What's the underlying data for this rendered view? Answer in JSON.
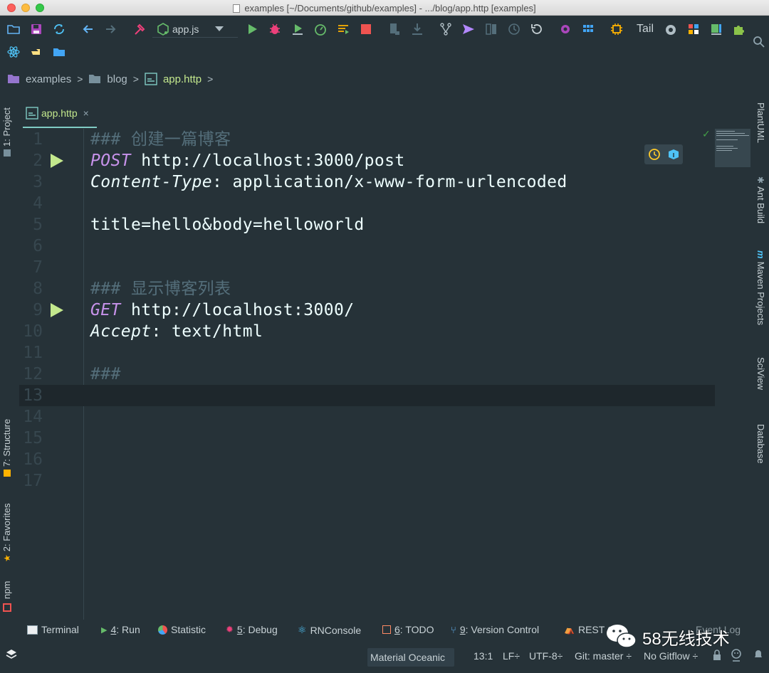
{
  "window": {
    "title": "examples [~/Documents/github/examples] - .../blog/app.http [examples]"
  },
  "toolbar": {
    "run_config": "app.js",
    "tail_label": "Tail"
  },
  "breadcrumb": {
    "items": [
      "examples",
      "blog",
      "app.http"
    ]
  },
  "left_tabs": {
    "project": "1: Project",
    "structure": "7: Structure",
    "favorites": "2: Favorites",
    "npm": "npm"
  },
  "right_tabs": {
    "plantuml": "PlantUML",
    "ant_build": "Ant Build",
    "maven": "Maven Projects",
    "sciview": "SciView",
    "database": "Database"
  },
  "editor": {
    "tab_label": "app.http",
    "current_line": 13,
    "lines": [
      {
        "n": "1",
        "segments": [
          {
            "t": "### 创建一篇博客",
            "c": "comment"
          }
        ]
      },
      {
        "n": "2",
        "run": true,
        "segments": [
          {
            "t": "POST",
            "c": "method"
          },
          {
            "t": " http://localhost:3000/post",
            "c": "plain"
          }
        ]
      },
      {
        "n": "3",
        "segments": [
          {
            "t": "Content-Type",
            "c": "header"
          },
          {
            "t": ": application/x-www-form-urlencoded",
            "c": "plain"
          }
        ]
      },
      {
        "n": "4",
        "segments": []
      },
      {
        "n": "5",
        "segments": [
          {
            "t": "title=hello&body=helloworld",
            "c": "plain"
          }
        ]
      },
      {
        "n": "6",
        "segments": []
      },
      {
        "n": "7",
        "segments": []
      },
      {
        "n": "8",
        "segments": [
          {
            "t": "### 显示博客列表",
            "c": "comment"
          }
        ]
      },
      {
        "n": "9",
        "run": true,
        "segments": [
          {
            "t": "GET",
            "c": "method"
          },
          {
            "t": " http://localhost:3000/",
            "c": "plain"
          }
        ]
      },
      {
        "n": "10",
        "segments": [
          {
            "t": "Accept",
            "c": "header"
          },
          {
            "t": ": text/html",
            "c": "plain"
          }
        ]
      },
      {
        "n": "11",
        "segments": []
      },
      {
        "n": "12",
        "segments": [
          {
            "t": "###",
            "c": "comment"
          }
        ]
      },
      {
        "n": "13",
        "segments": []
      },
      {
        "n": "14",
        "segments": []
      },
      {
        "n": "15",
        "segments": []
      },
      {
        "n": "16",
        "segments": []
      },
      {
        "n": "17",
        "segments": []
      }
    ]
  },
  "bottom_tools": {
    "terminal": "Terminal",
    "run_num": "4",
    "run_label": ": Run",
    "statistic": "Statistic",
    "debug_num": "5",
    "debug_label": ": Debug",
    "rnconsole": "RNConsole",
    "todo_num": "6",
    "todo_label": ": TODO",
    "vcs_num": "9",
    "vcs_label": ": Version Control",
    "rest": "REST Cl",
    "event_log": "Event Log"
  },
  "status_bar": {
    "theme": "Material Oceanic",
    "position": "13:1",
    "line_sep": "LF÷",
    "encoding": "UTF-8÷",
    "git": "Git: master ÷",
    "gitflow": "No Gitflow ÷"
  },
  "watermark": {
    "text": "58无线技术"
  },
  "colors": {
    "background": "#263238",
    "comment": "#546e7a",
    "method": "#c792ea",
    "plain": "#eeffff",
    "accent_green": "#c3e88d",
    "line_number": "#37474f"
  }
}
